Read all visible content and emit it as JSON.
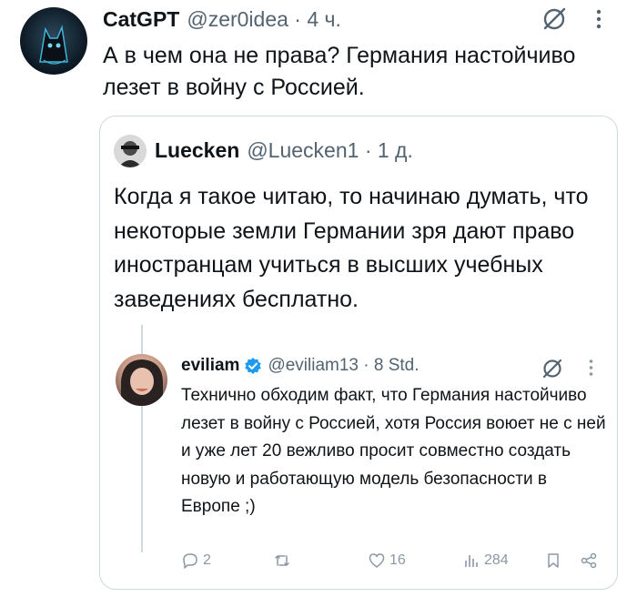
{
  "main_tweet": {
    "name": "CatGPT",
    "handle_time": "@zer0idea · 4 ч.",
    "text": "А в чем она не права? Германия настойчиво лезет в войну с Россией."
  },
  "quoted_tweet": {
    "name": "Luecken",
    "handle_time": "@Luecken1 · 1 д.",
    "text": "Когда я такое читаю, то начинаю думать, что некоторые земли Германии зря дают право иностранцам учиться в высших учебных заведениях бесплатно."
  },
  "reply_tweet": {
    "name": "eviliam",
    "handle_time": "@eviliam13 · 8 Std.",
    "text": "Технично обходим факт, что Германия настойчиво лезет в войну с Россией, хотя Россия воюет не с ней и уже лет 20 вежливо просит совместно создать новую и работающую модель безопасности в Европе ;)",
    "actions": {
      "replies": "2",
      "retweets": "",
      "likes": "16",
      "views": "284"
    }
  },
  "colors": {
    "text": "#0f1419",
    "secondary": "#536471",
    "border": "#cfd9de",
    "verified": "#1d9bf0",
    "action_icon": "#8b98a5"
  },
  "icons": [
    "grok-icon",
    "more-icon",
    "verified-badge-icon",
    "reply-icon",
    "retweet-icon",
    "like-icon",
    "views-icon",
    "bookmark-icon",
    "share-icon"
  ]
}
